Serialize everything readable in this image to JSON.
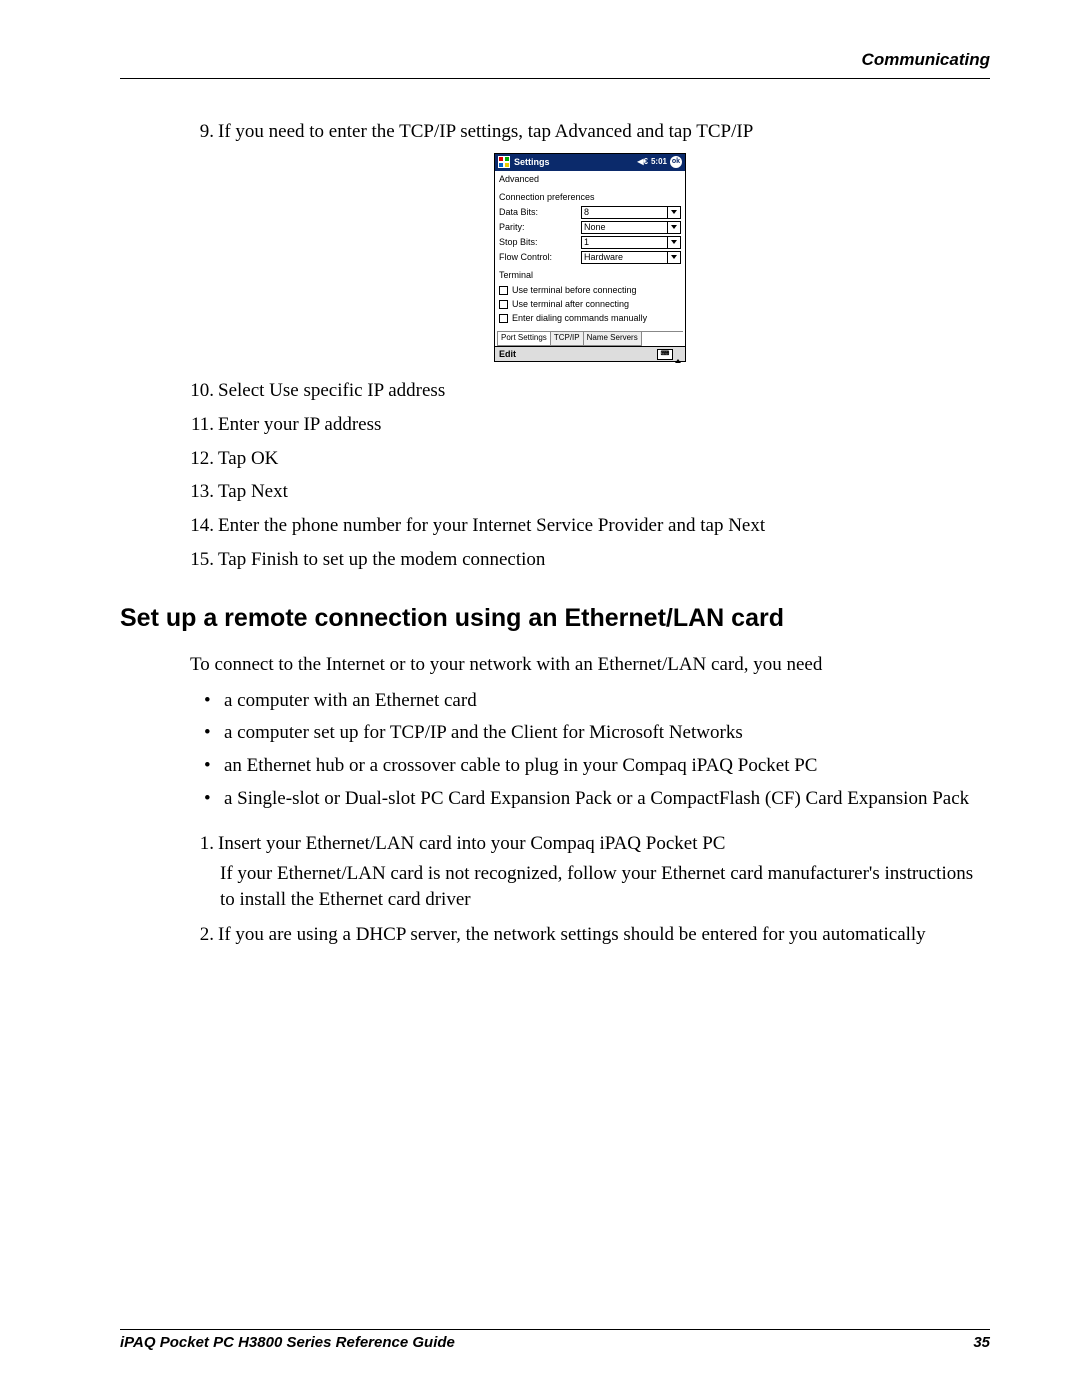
{
  "header": {
    "chapter": "Communicating"
  },
  "steps_a": [
    {
      "n": "9.",
      "t": "If you need to enter the TCP/IP settings, tap Advanced and tap TCP/IP"
    }
  ],
  "ppc": {
    "title": "Settings",
    "time": "5:01",
    "ok": "ok",
    "advanced": "Advanced",
    "conn_pref": "Connection preferences",
    "rows": [
      {
        "label": "Data Bits:",
        "value": "8"
      },
      {
        "label": "Parity:",
        "value": "None"
      },
      {
        "label": "Stop Bits:",
        "value": "1"
      },
      {
        "label": "Flow Control:",
        "value": "Hardware"
      }
    ],
    "terminal": "Terminal",
    "checks": [
      "Use terminal before connecting",
      "Use terminal after connecting",
      "Enter dialing commands manually"
    ],
    "tabs": [
      "Port Settings",
      "TCP/IP",
      "Name Servers"
    ],
    "edit": "Edit"
  },
  "steps_b": [
    {
      "n": "10.",
      "t": "Select Use specific IP address"
    },
    {
      "n": "11.",
      "t": "Enter your IP address"
    },
    {
      "n": "12.",
      "t": "Tap OK"
    },
    {
      "n": "13.",
      "t": "Tap Next"
    },
    {
      "n": "14.",
      "t": "Enter the phone number for your Internet Service Provider and tap Next"
    },
    {
      "n": "15.",
      "t": "Tap Finish to set up the modem connection"
    }
  ],
  "section_title": "Set up a remote connection using an Ethernet/LAN card",
  "intro": "To connect to the Internet or to your network with an Ethernet/LAN card, you need",
  "bullets": [
    "a computer with an Ethernet card",
    "a computer set up for TCP/IP and the Client for Microsoft Networks",
    "an Ethernet hub or a crossover cable to plug in your Compaq iPAQ Pocket PC",
    "a Single-slot or Dual-slot PC Card Expansion Pack or a CompactFlash (CF) Card Expansion Pack"
  ],
  "steps_c": [
    {
      "n": "1.",
      "t": "Insert your Ethernet/LAN card into your Compaq iPAQ Pocket PC",
      "follow": "If your Ethernet/LAN card is not recognized, follow your Ethernet card manufacturer's instructions to install the Ethernet card driver"
    },
    {
      "n": "2.",
      "t": "If you are using a DHCP server, the network settings should be entered for you automatically"
    }
  ],
  "footer": {
    "left": "iPAQ Pocket PC H3800 Series Reference Guide",
    "right": "35"
  }
}
